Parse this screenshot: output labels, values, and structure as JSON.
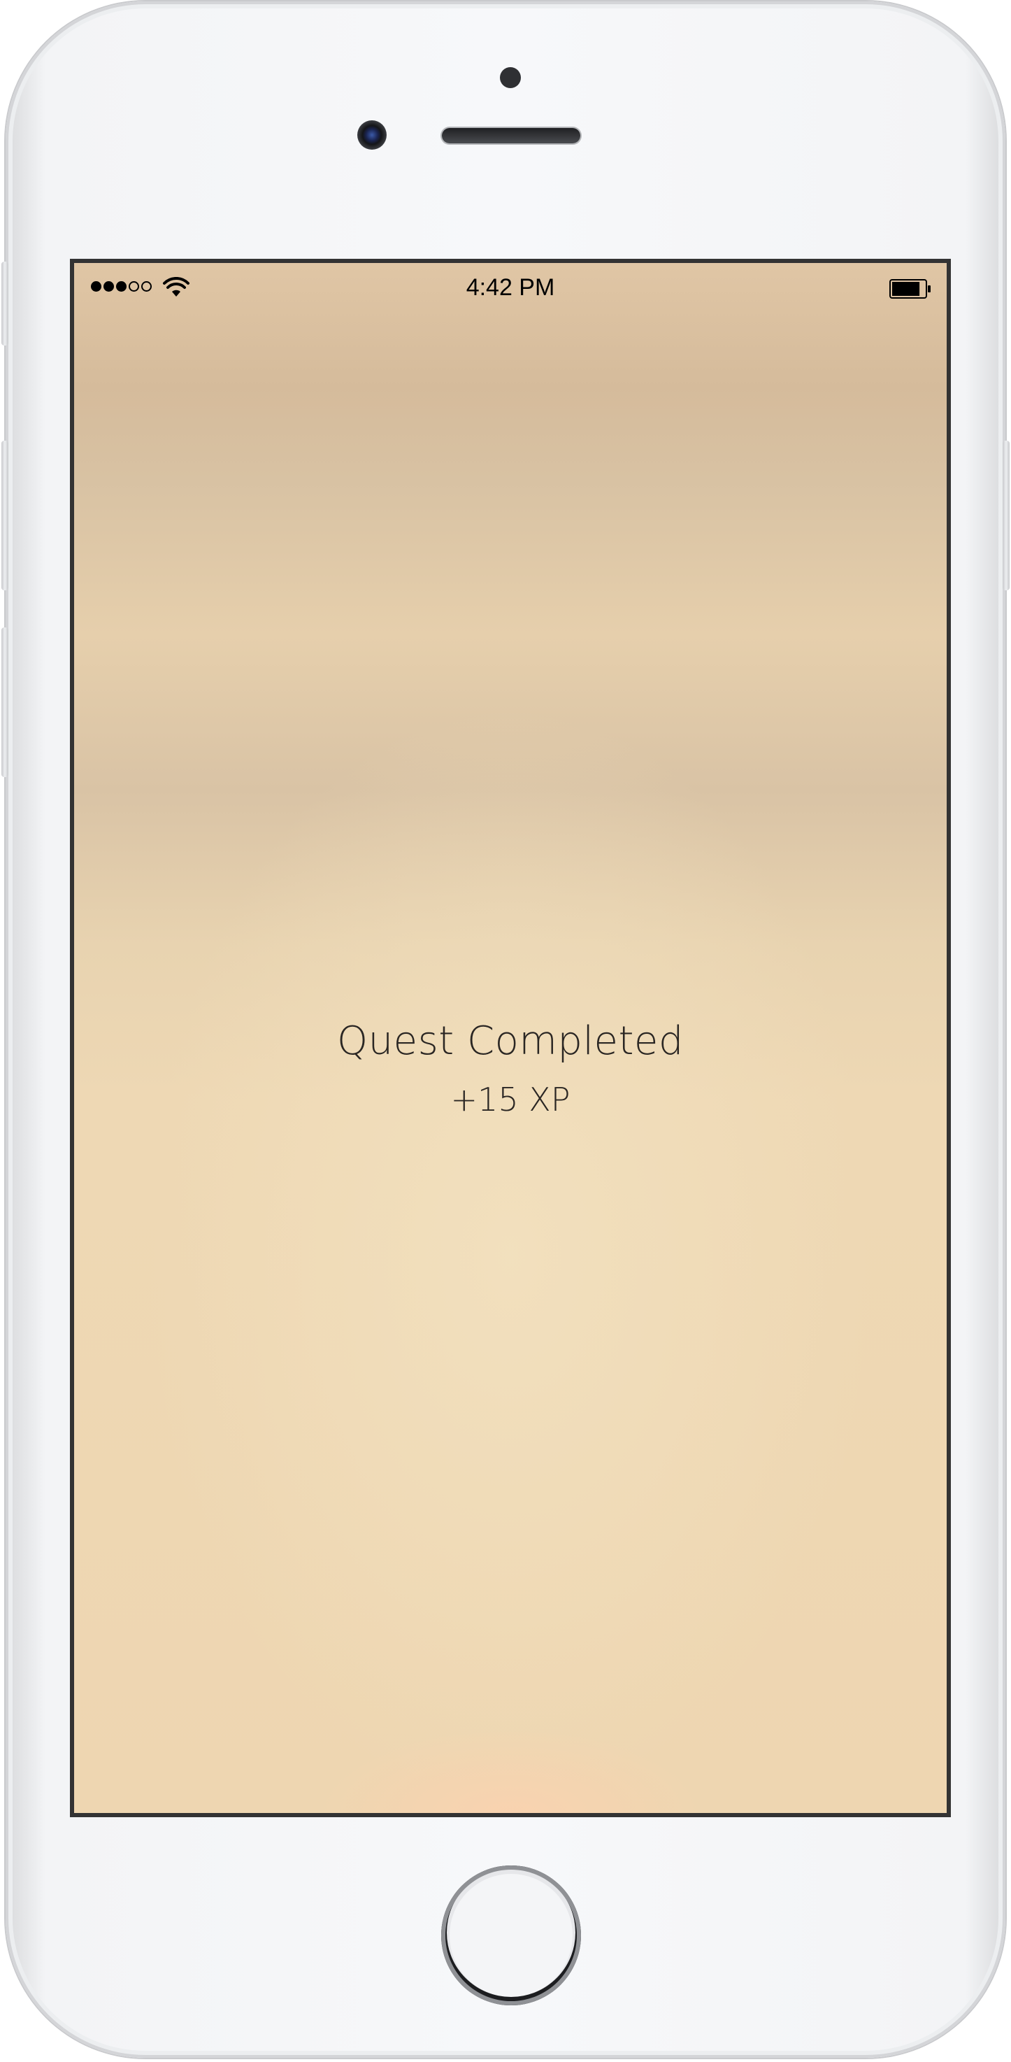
{
  "status_bar": {
    "signal": {
      "filled": 3,
      "total": 5
    },
    "wifi_icon": "wifi-icon",
    "time": "4:42 PM",
    "battery_icon": "battery-icon",
    "battery_level": 0.85
  },
  "notification": {
    "title": "Quest Completed",
    "reward": "+15 XP"
  },
  "colors": {
    "text": "#2a2623",
    "bezel": "#333333",
    "device_body": "#f6f7f9"
  }
}
